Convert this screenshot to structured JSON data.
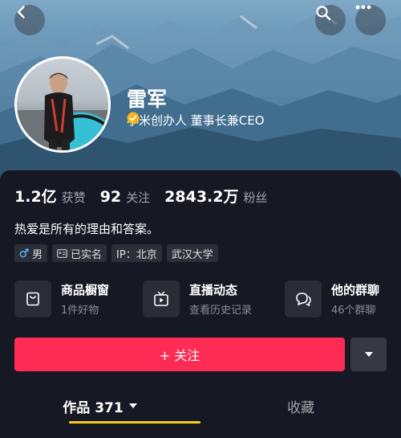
{
  "header": {
    "back_icon": "chevron-left-icon",
    "search_icon": "search-icon",
    "more_icon": "more-horizontal-icon"
  },
  "profile": {
    "name": "雷军",
    "verification_text": "小米创办人 董事长兼CEO",
    "verified_badge_color": "#f5b51b"
  },
  "stats": [
    {
      "value": "1.2亿",
      "label": "获赞"
    },
    {
      "value": "92",
      "label": "关注"
    },
    {
      "value": "2843.2万",
      "label": "粉丝"
    }
  ],
  "bio": "热爱是所有的理由和答案。",
  "tags": [
    {
      "icon": "male-icon",
      "label": "男"
    },
    {
      "icon": "id-card-icon",
      "label": "已实名"
    },
    {
      "icon": "",
      "label": "IP：北京"
    },
    {
      "icon": "",
      "label": "武汉大学"
    }
  ],
  "features": [
    {
      "icon": "shopping-bag-icon",
      "title": "商品橱窗",
      "subtitle": "1件好物"
    },
    {
      "icon": "tv-play-icon",
      "title": "直播动态",
      "subtitle": "查看历史记录"
    },
    {
      "icon": "group-chat-icon",
      "title": "他的群聊",
      "subtitle": "46个群聊"
    }
  ],
  "follow_button": {
    "label": "+ 关注",
    "color": "#fe2c55"
  },
  "tabs": [
    {
      "label": "作品 371",
      "active": true
    },
    {
      "label": "收藏",
      "active": false
    }
  ],
  "accent_color": "#facc15"
}
